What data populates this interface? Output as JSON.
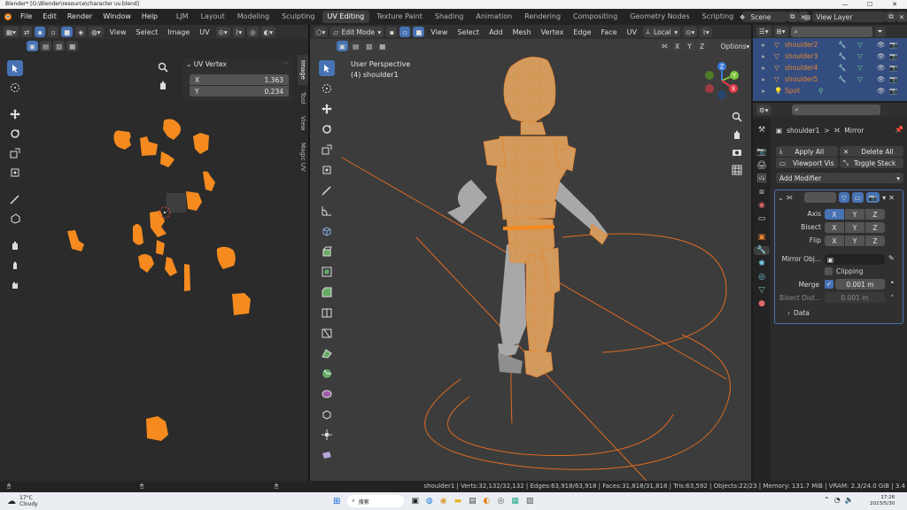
{
  "window": {
    "title": "Blender* [G:\\Blender\\resource\\character uv.blend]"
  },
  "menu": {
    "items": [
      "File",
      "Edit",
      "Render",
      "Window",
      "Help"
    ]
  },
  "workspaces": {
    "tabs": [
      "LJM",
      "Layout",
      "Modeling",
      "Sculpting",
      "UV Editing",
      "Texture Paint",
      "Shading",
      "Animation",
      "Rendering",
      "Compositing",
      "Geometry Nodes",
      "Scripting"
    ],
    "active": "UV Editing"
  },
  "scene": {
    "label": "Scene"
  },
  "view_layer": {
    "label": "View Layer"
  },
  "uv_editor": {
    "menus": [
      "View",
      "Select",
      "Image",
      "UV"
    ],
    "panel_title": "UV Vertex",
    "x_label": "X",
    "x_value": "1.363",
    "y_label": "Y",
    "y_value": "0.234",
    "side_tabs": [
      "Image",
      "Tool",
      "View",
      "Magic UV"
    ]
  },
  "viewport": {
    "mode": "Edit Mode",
    "menus": [
      "View",
      "Select",
      "Add",
      "Mesh",
      "Vertex",
      "Edge",
      "Face",
      "UV"
    ],
    "transform": "Local",
    "axes": [
      "X",
      "Y",
      "Z"
    ],
    "options": "Options",
    "overlay_title": "User Perspective",
    "overlay_object": "(4) shoulder1",
    "gizmo_labels": [
      "Z",
      "Y",
      "X"
    ]
  },
  "outliner": {
    "items": [
      {
        "name": "shoulder2",
        "color": "#e8862e"
      },
      {
        "name": "shoulder3",
        "color": "#e8862e"
      },
      {
        "name": "shoulder4",
        "color": "#e8862e"
      },
      {
        "name": "shoulder5",
        "color": "#e8862e"
      },
      {
        "name": "Spot",
        "color": "#e8862e"
      }
    ]
  },
  "properties": {
    "breadcrumb_object": "shoulder1",
    "breadcrumb_sep": ">",
    "breadcrumb_modifier": "Mirror",
    "apply_all": "Apply All",
    "delete_all": "Delete All",
    "viewport_vis": "Viewport Vis",
    "toggle_stack": "Toggle Stack",
    "add_modifier": "Add Modifier",
    "axis_label": "Axis",
    "bisect_label": "Bisect",
    "flip_label": "Flip",
    "xyz": [
      "X",
      "Y",
      "Z"
    ],
    "mirror_object_label": "Mirror Obj...",
    "clipping_label": "Clipping",
    "merge_label": "Merge",
    "merge_value": "0.001 m",
    "bisect_dist_label": "Bisect Dist...",
    "bisect_dist_value": "0.001 m",
    "data_label": "Data"
  },
  "statusbar": {
    "text": "shoulder1 | Verts:32,132/32,132 | Edges:63,918/63,918 | Faces:31,818/31,818 | Tris:63,592 | Objects:22/23 | Memory: 131.7 MiB | VRAM: 2.3/24.0 GiB | 3.4"
  },
  "taskbar": {
    "weather_temp": "17°C",
    "weather_text": "Cloudy",
    "search": "搜索",
    "time": "17:26",
    "date": "2023/5/30"
  },
  "colors": {
    "accent": "#4772b3",
    "uv_island": "#f58a1f",
    "selected_orange": "#e8862e"
  }
}
